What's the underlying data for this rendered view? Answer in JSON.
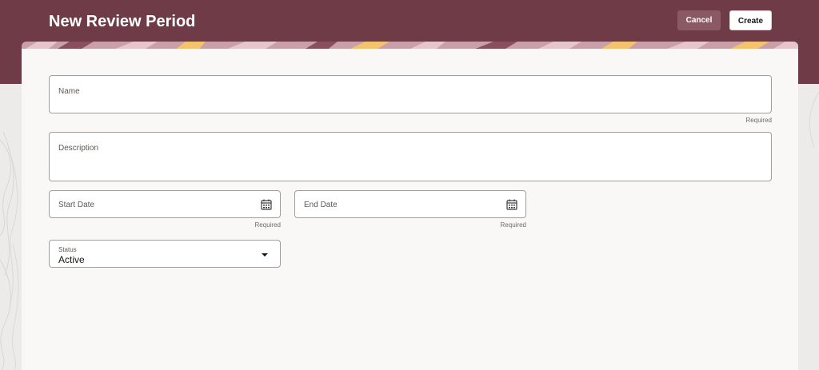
{
  "header": {
    "title": "New Review Period",
    "cancel_label": "Cancel",
    "create_label": "Create"
  },
  "form": {
    "name": {
      "label": "Name",
      "helper": "Required"
    },
    "description": {
      "label": "Description"
    },
    "start_date": {
      "label": "Start Date",
      "helper": "Required",
      "icon": "calendar-icon"
    },
    "end_date": {
      "label": "End Date",
      "helper": "Required",
      "icon": "calendar-icon"
    },
    "status": {
      "label": "Status",
      "value": "Active",
      "icon": "chevron-down-icon"
    }
  },
  "colors": {
    "header_bg": "#6e3b47",
    "card_bg": "#f9f8f6",
    "field_border": "#a19f9d"
  }
}
